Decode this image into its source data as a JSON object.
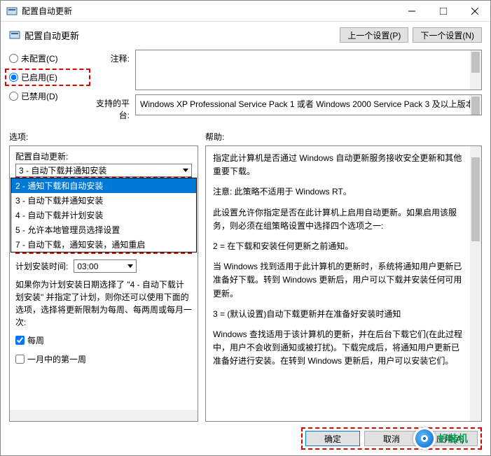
{
  "title": "配置自动更新",
  "window_icon": "policy-icon",
  "heading": "配置自动更新",
  "nav": {
    "prev": "上一个设置(P)",
    "next": "下一个设置(N)"
  },
  "radios": {
    "not_configured": "未配置(C)",
    "enabled": "已启用(E)",
    "disabled": "已禁用(D)"
  },
  "labels": {
    "comment": "注释:",
    "platform": "支持的平台:",
    "options": "选项:",
    "help": "帮助:",
    "combo": "配置自动更新:",
    "schedule_time": "计划安装时间:",
    "weekly": "每周",
    "first_week": "一月中的第一周"
  },
  "comment_text": "",
  "platform_text": "Windows XP Professional Service Pack 1 或者 Windows 2000 Service Pack 3 及以上版本",
  "combo_selected": "3 - 自动下载并通知安装",
  "combo_items": [
    "2 - 通知下载和自动安装",
    "3 - 自动下载并通知安装",
    "4 - 自动下载并计划安装",
    "5 - 允许本地管理员选择设置",
    "7 - 自动下载，通知安装，通知重启"
  ],
  "time_value": "03:00",
  "options_desc": "如果你为计划安装日期选择了 \"4 - 自动下载计划安装\" 并指定了计划，则你还可以使用下面的选项，选择将更新限制为每周、每两周或每月一次:",
  "help_paragraphs": [
    "指定此计算机是否通过 Windows 自动更新服务接收安全更新和其他重要下载。",
    "注意: 此策略不适用于 Windows RT。",
    "此设置允许你指定是否在此计算机上启用自动更新。如果启用该服务，则必须在组策略设置中选择四个选项之一:",
    "2 = 在下载和安装任何更新之前通知。",
    "    当 Windows 找到适用于此计算机的更新时，系统将通知用户更新已准备好下载。转到 Windows 更新后，用户可以下载并安装任何可用更新。",
    "3 = (默认设置)自动下载更新并在准备好安装时通知",
    "    Windows 查找适用于该计算机的更新，并在后台下载它们(在此过程中，用户不会收到通知或被打扰)。下载完成后，将通知用户更新已准备好进行安装。在转到 Windows 更新后，用户可以安装它们。"
  ],
  "buttons": {
    "ok": "确定",
    "cancel": "取消",
    "apply": "应用(A)"
  },
  "watermark": "好装机"
}
